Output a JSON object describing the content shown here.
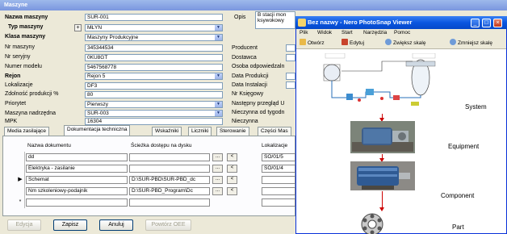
{
  "main": {
    "title": "Maszyne",
    "fields": {
      "nazwa_label": "Nazwa maszyny",
      "nazwa_value": "SUR-001",
      "typ_label": "Typ maszyny",
      "typ_value": "MŁYN",
      "klasa_label": "Klasa maszyny",
      "klasa_value": "Maszyny Produkcyjne",
      "nr_label": "Nr maszyny",
      "nr_value": "345344534",
      "seryjny_label": "Nr seryjny",
      "seryjny_value": "0KU8GT",
      "model_label": "Numer modelu",
      "model_value": "5467568778",
      "rejon_label": "Rejon",
      "rejon_value": "Rejon 5",
      "lokal_label": "Lokalizacje",
      "lokal_value": "DF3",
      "zdol_label": "Zdolność produkcji %",
      "zdol_value": "80",
      "prior_label": "Priorytet",
      "prior_value": "Pierwszy",
      "nadrz_label": "Maszyna nadrzędna",
      "nadrz_value": "SUR-003",
      "mpk_label": "MPK",
      "mpk_value": "16304",
      "plus": "+"
    },
    "right_labels": {
      "opis": "Opis",
      "opis_text": "B stacji mon ksywokowy",
      "producent": "Producent",
      "dostawca": "Dostawca",
      "osoba": "Osoba odpowiedzaln",
      "data_prod": "Data Produkcji",
      "data_inst": "Data Instalacji",
      "nr_ksieg": "Nr Księgowy",
      "nastepny": "Następny przegląd U",
      "niecz_tyg": "Nieczynna od tygodn",
      "nieczynna": "Nieczynna"
    },
    "tabs": [
      "Media zasilające",
      "Dokumentacja techniczna",
      "Wskaźniki",
      "Liczniki",
      "Sterowanie",
      "Części Mas"
    ],
    "grid": {
      "col_name": "Nazwa dokumentu",
      "col_path": "Ścieżka dostępu na dysku",
      "col_loc": "Lokalizacje",
      "rows": [
        {
          "name": "dd",
          "path": "",
          "loc": "SO/01/5",
          "marker": ""
        },
        {
          "name": "Elektryka - zasilanie",
          "path": "",
          "loc": "SO/01/4",
          "marker": ""
        },
        {
          "name": "Schemat",
          "path": "D:\\SUR-PBD\\SUR-PBD_dc",
          "loc": "",
          "marker": "▶"
        },
        {
          "name": "Nm szkoleniowy-podajnik",
          "path": "D:\\SUR-PBD_Program\\Dc",
          "loc": "",
          "marker": ""
        },
        {
          "name": "",
          "path": "",
          "loc": "",
          "marker": "*"
        }
      ],
      "dots": "...",
      "arrow_btn": "<"
    },
    "buttons": {
      "edit": "Edycja",
      "save": "Zapisz",
      "cancel": "Anuluj",
      "repeat": "Powtórz OEE"
    }
  },
  "viewer": {
    "title": "Bez nazwy - Nero PhotoSnap Viewer",
    "menu": [
      "Plik",
      "Widok",
      "Start",
      "Narzędzia",
      "Pomoc"
    ],
    "toolbar": {
      "open": "Otwórz",
      "edit": "Edytuj",
      "zoom_in": "Zwiększ skalę",
      "zoom_out": "Zmniejsz skalę"
    },
    "labels": {
      "system": "System",
      "equipment": "Equipment",
      "component": "Component",
      "part": "Part"
    },
    "colors": {
      "arrow": "#cc0000",
      "title_bar": "#0a56e0"
    }
  }
}
